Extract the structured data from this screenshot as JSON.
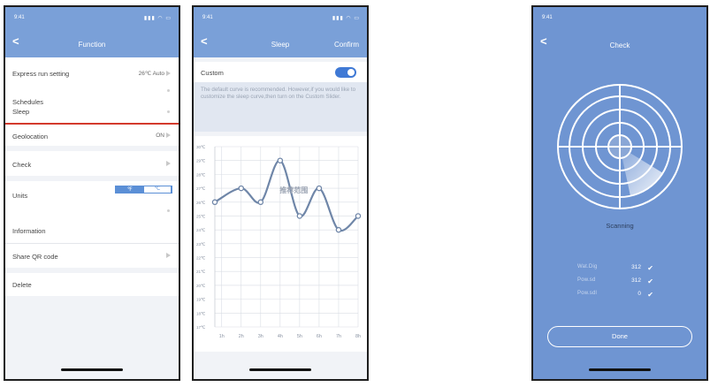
{
  "status_time": "9:41",
  "function_screen": {
    "title": "Function",
    "express_label": "Express run setting",
    "express_value": "26℃ Auto",
    "schedules_label": "Schedules",
    "sleep_label": "Sleep",
    "geolocation_label": "Geolocation",
    "geolocation_value": "ON",
    "check_label": "Check",
    "units_label": "Units",
    "units_f": "℉",
    "units_c": "℃",
    "information_label": "Information",
    "share_label": "Share QR code",
    "delete_label": "Delete"
  },
  "sleep_screen": {
    "title": "Sleep",
    "confirm_label": "Confirm",
    "custom_label": "Custom",
    "custom_enabled": true,
    "description": "The default curve is recommended. However,if you would like to customize the sleep curve,then turn on the Custom Slider.",
    "watermark": "推荐范围"
  },
  "chart_data": {
    "type": "line",
    "y_ticks": [
      "30℃",
      "29℃",
      "28℃",
      "27℃",
      "26℃",
      "25℃",
      "24℃",
      "23℃",
      "22℃",
      "21℃",
      "20℃",
      "19℃",
      "18℃",
      "17℃"
    ],
    "x": [
      "1h",
      "2h",
      "3h",
      "4h",
      "5h",
      "6h",
      "7h",
      "8h"
    ],
    "ylim": [
      17,
      30
    ],
    "series": [
      {
        "x_pos": [
          0.65,
          2.0,
          3.0,
          4.0,
          5.0,
          6.0,
          7.0,
          8.0
        ],
        "values": [
          26.0,
          27.0,
          26.0,
          29.0,
          25.0,
          27.0,
          24.0,
          25.0
        ]
      }
    ]
  },
  "check_screen": {
    "title": "Check",
    "scanning_label": "Scanning",
    "items": [
      {
        "name": "Wat.Dig",
        "value": "312"
      },
      {
        "name": "Pow.sd",
        "value": "312"
      },
      {
        "name": "Pow.sdl",
        "value": "0"
      }
    ],
    "done_label": "Done"
  },
  "colors": {
    "header": "#7aa0d8",
    "check_bg": "#6f95d2",
    "accent": "#3f79d5",
    "divider_red": "#d33a2c"
  }
}
